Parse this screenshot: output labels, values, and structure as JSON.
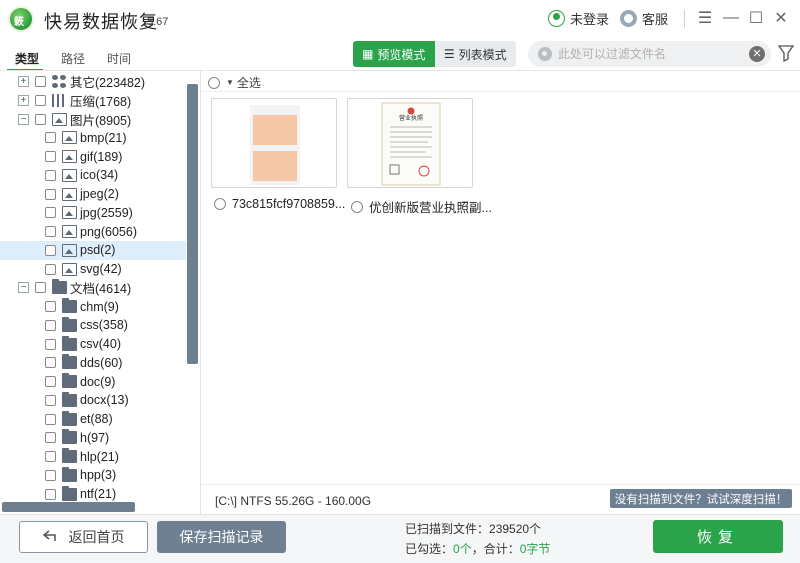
{
  "app": {
    "title": "快易数据恢复",
    "version": "5.67",
    "logo_text": "簌"
  },
  "header": {
    "login_label": "未登录",
    "service_label": "客服"
  },
  "window_controls": {
    "menu": "☰",
    "minimize": "—",
    "maximize": "☐",
    "close": "✕"
  },
  "tabs": [
    {
      "label": "类型"
    },
    {
      "label": "路径"
    },
    {
      "label": "时间"
    }
  ],
  "view_modes": {
    "preview": "预览模式",
    "list": "列表模式",
    "active": "preview"
  },
  "search": {
    "placeholder": "此处可以过滤文件名"
  },
  "tree": [
    {
      "label": "其它(223482)",
      "icon": "dots",
      "level": 0,
      "expander": "+"
    },
    {
      "label": "压缩(1768)",
      "icon": "grid",
      "level": 0,
      "expander": "+"
    },
    {
      "label": "图片(8905)",
      "icon": "image",
      "level": 0,
      "expander": "−"
    },
    {
      "label": "bmp(21)",
      "icon": "image",
      "level": 1
    },
    {
      "label": "gif(189)",
      "icon": "image",
      "level": 1
    },
    {
      "label": "ico(34)",
      "icon": "image",
      "level": 1
    },
    {
      "label": "jpeg(2)",
      "icon": "image",
      "level": 1
    },
    {
      "label": "jpg(2559)",
      "icon": "image",
      "level": 1
    },
    {
      "label": "png(6056)",
      "icon": "image",
      "level": 1
    },
    {
      "label": "psd(2)",
      "icon": "image",
      "level": 1,
      "selected": true
    },
    {
      "label": "svg(42)",
      "icon": "image",
      "level": 1
    },
    {
      "label": "文档(4614)",
      "icon": "folder",
      "level": 0,
      "expander": "−"
    },
    {
      "label": "chm(9)",
      "icon": "folder",
      "level": 1
    },
    {
      "label": "css(358)",
      "icon": "folder",
      "level": 1
    },
    {
      "label": "csv(40)",
      "icon": "folder",
      "level": 1
    },
    {
      "label": "dds(60)",
      "icon": "folder",
      "level": 1
    },
    {
      "label": "doc(9)",
      "icon": "folder",
      "level": 1
    },
    {
      "label": "docx(13)",
      "icon": "folder",
      "level": 1
    },
    {
      "label": "et(88)",
      "icon": "folder",
      "level": 1
    },
    {
      "label": "h(97)",
      "icon": "folder",
      "level": 1
    },
    {
      "label": "hlp(21)",
      "icon": "folder",
      "level": 1
    },
    {
      "label": "hpp(3)",
      "icon": "folder",
      "level": 1
    },
    {
      "label": "ntf(21)",
      "icon": "folder",
      "level": 1
    }
  ],
  "main": {
    "select_all_label": "全选",
    "files": [
      {
        "name": "73c815fcf9708859..."
      },
      {
        "name": "优创新版营业执照副..."
      }
    ],
    "license_title": "营业执照"
  },
  "status": {
    "drive_info": "[C:\\] NTFS 55.26G - 160.00G",
    "deep_scan_label": "没有扫描到文件？试试深度扫描！"
  },
  "footer": {
    "home_label": "返回首页",
    "save_label": "保存扫描记录",
    "scanned_prefix": "已扫描到文件：",
    "scanned_count": "239520个",
    "selected_prefix": "已勾选：",
    "selected_count": "0个",
    "total_prefix": "，合计：",
    "total_size": "0字节",
    "recover_label": "恢复"
  },
  "colors": {
    "accent": "#2aa34a",
    "slate": "#6e8091",
    "selected_row": "#dfeefb"
  }
}
